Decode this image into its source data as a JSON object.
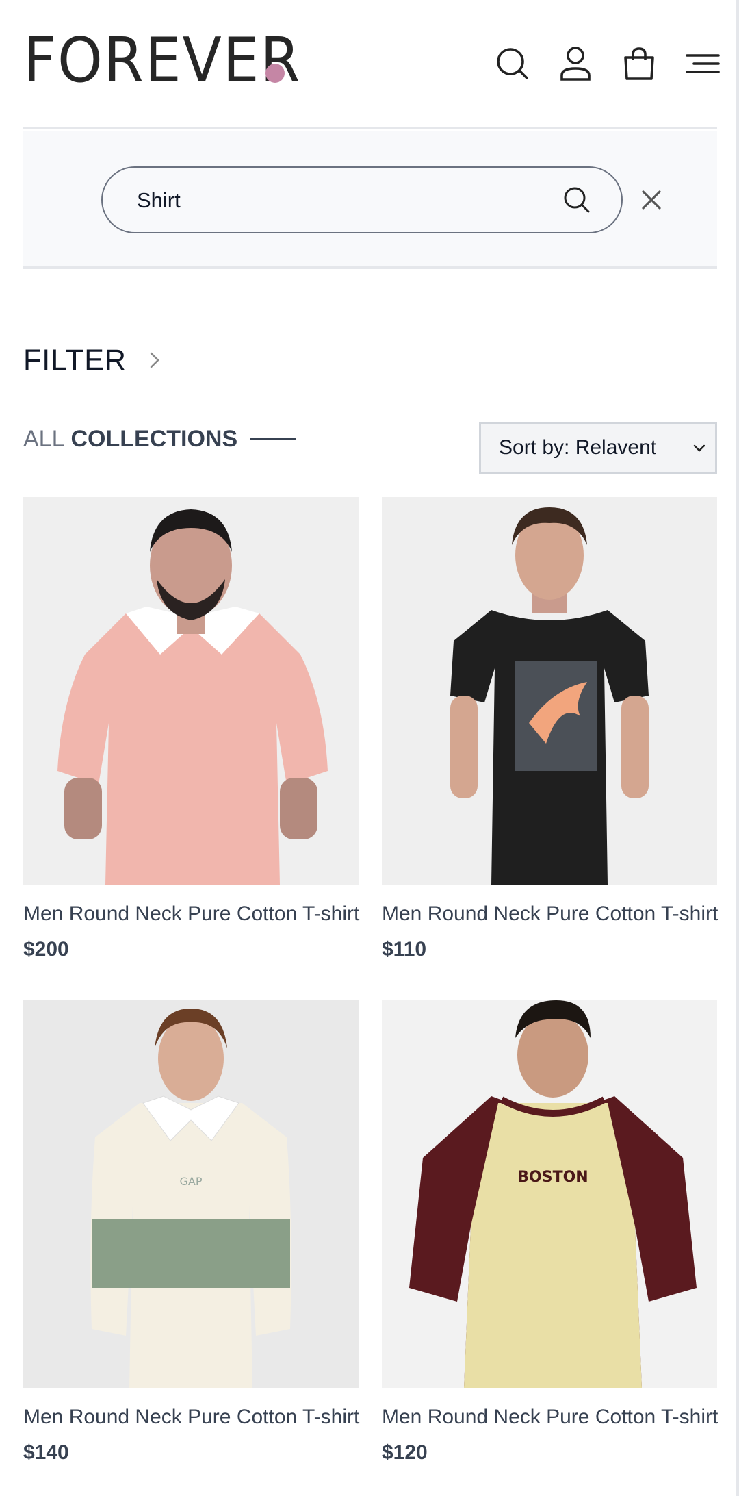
{
  "brand": {
    "logo_text": "FOREVER",
    "dot_color": "#c586a5"
  },
  "header": {
    "icons": [
      "search-icon",
      "profile-icon",
      "cart-icon",
      "menu-icon"
    ]
  },
  "search": {
    "value": "Shirt",
    "placeholder": "Search"
  },
  "filter": {
    "label": "FILTER"
  },
  "collections": {
    "title_prefix": "ALL",
    "title_main": "COLLECTIONS"
  },
  "sort": {
    "selected": "Sort by: Relavent"
  },
  "products": [
    {
      "name": "Men Round Neck Pure Cotton T-shirt",
      "price": "$200",
      "shirt_color": "#f1b6ad",
      "collar_color": "#ffffff"
    },
    {
      "name": "Men Round Neck Pure Cotton T-shirt",
      "price": "$110",
      "shirt_color": "#1f1f1f",
      "print_color": "#f2a57d"
    },
    {
      "name": "Men Round Neck Pure Cotton T-shirt",
      "price": "$140",
      "shirt_color": "#f4efe2",
      "stripe_color": "#8a9f88",
      "chest_text": "GAP"
    },
    {
      "name": "Men Round Neck Pure Cotton T-shirt",
      "price": "$120",
      "shirt_color": "#e9dfa6",
      "sleeve_color": "#5a1a1f",
      "chest_text": "BOSTON"
    }
  ]
}
